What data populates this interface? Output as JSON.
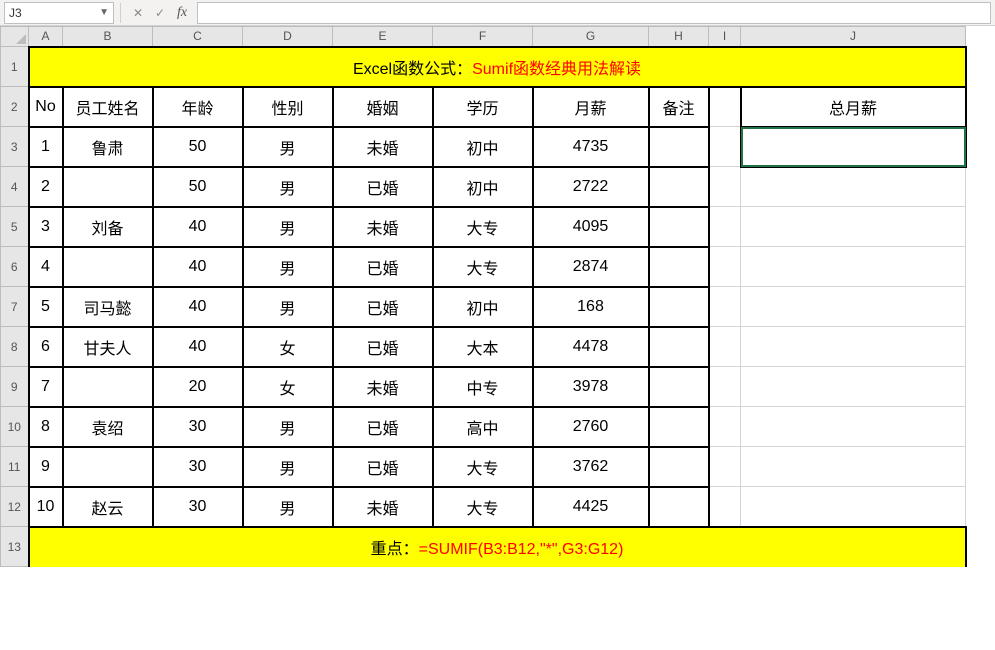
{
  "formula_bar": {
    "name_box": "J3",
    "cancel": "✕",
    "confirm": "✓",
    "fx": "fx",
    "value": ""
  },
  "columns": [
    "A",
    "B",
    "C",
    "D",
    "E",
    "F",
    "G",
    "H",
    "I",
    "J"
  ],
  "row_numbers": [
    "1",
    "2",
    "3",
    "4",
    "5",
    "6",
    "7",
    "8",
    "9",
    "10",
    "11",
    "12",
    "13"
  ],
  "title": {
    "prefix": "Excel函数公式：",
    "suffix": "Sumif函数经典用法解读"
  },
  "headers": {
    "no": "No",
    "name": "员工姓名",
    "age": "年龄",
    "gender": "性别",
    "marital": "婚姻",
    "edu": "学历",
    "salary": "月薪",
    "note": "备注",
    "total": "总月薪"
  },
  "rows": [
    {
      "no": "1",
      "name": "鲁肃",
      "age": "50",
      "gender": "男",
      "marital": "未婚",
      "edu": "初中",
      "salary": "4735",
      "note": ""
    },
    {
      "no": "2",
      "name": "",
      "age": "50",
      "gender": "男",
      "marital": "已婚",
      "edu": "初中",
      "salary": "2722",
      "note": ""
    },
    {
      "no": "3",
      "name": "刘备",
      "age": "40",
      "gender": "男",
      "marital": "未婚",
      "edu": "大专",
      "salary": "4095",
      "note": ""
    },
    {
      "no": "4",
      "name": "",
      "age": "40",
      "gender": "男",
      "marital": "已婚",
      "edu": "大专",
      "salary": "2874",
      "note": ""
    },
    {
      "no": "5",
      "name": "司马懿",
      "age": "40",
      "gender": "男",
      "marital": "已婚",
      "edu": "初中",
      "salary": "168",
      "note": ""
    },
    {
      "no": "6",
      "name": "甘夫人",
      "age": "40",
      "gender": "女",
      "marital": "已婚",
      "edu": "大本",
      "salary": "4478",
      "note": ""
    },
    {
      "no": "7",
      "name": "",
      "age": "20",
      "gender": "女",
      "marital": "未婚",
      "edu": "中专",
      "salary": "3978",
      "note": ""
    },
    {
      "no": "8",
      "name": "袁绍",
      "age": "30",
      "gender": "男",
      "marital": "已婚",
      "edu": "高中",
      "salary": "2760",
      "note": ""
    },
    {
      "no": "9",
      "name": "",
      "age": "30",
      "gender": "男",
      "marital": "已婚",
      "edu": "大专",
      "salary": "3762",
      "note": ""
    },
    {
      "no": "10",
      "name": "赵云",
      "age": "30",
      "gender": "男",
      "marital": "未婚",
      "edu": "大专",
      "salary": "4425",
      "note": ""
    }
  ],
  "total_value": "",
  "footer": {
    "prefix": "重点：",
    "formula": "=SUMIF(B3:B12,\"*\",G3:G12)"
  },
  "selected_cell": "J3"
}
